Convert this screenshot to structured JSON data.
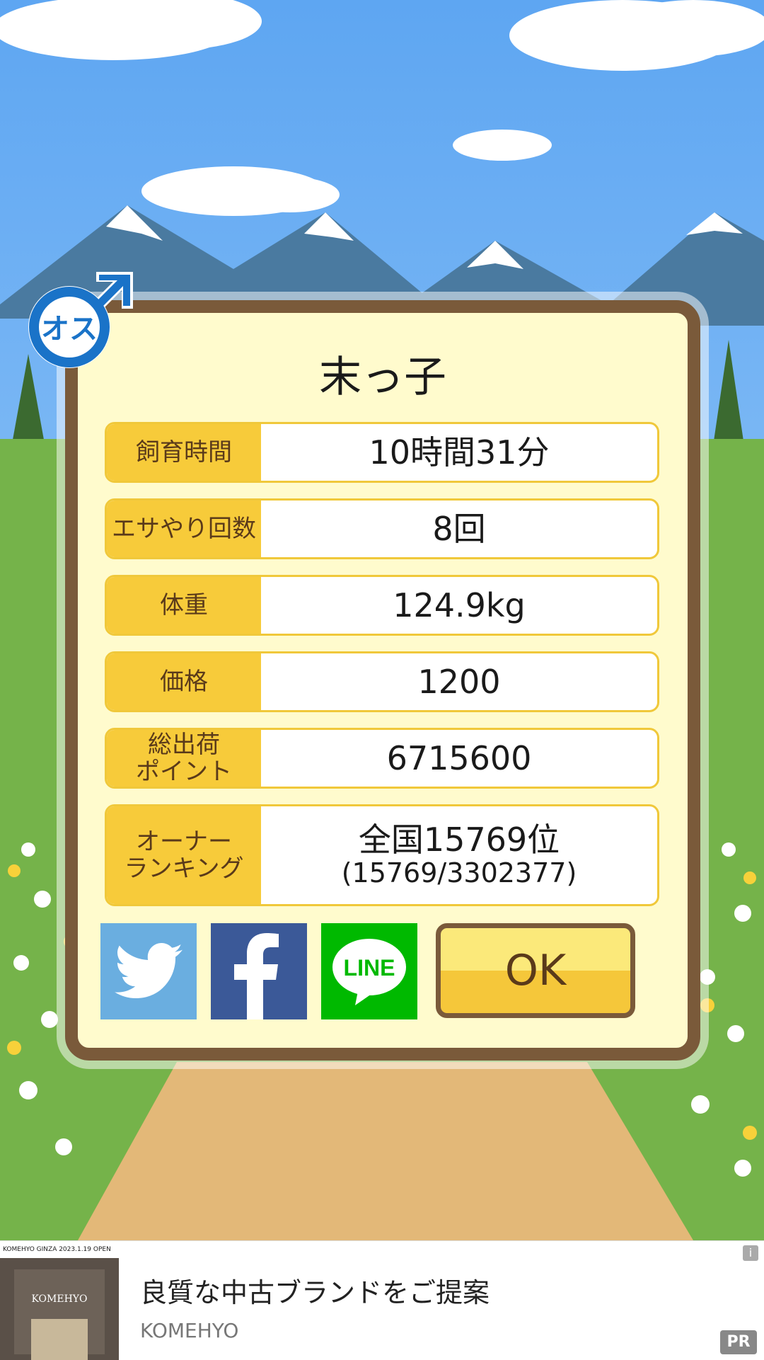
{
  "pig": {
    "name": "末っ子",
    "gender_label": "オス"
  },
  "stats": [
    {
      "label": "飼育時間",
      "value": "10時間31分"
    },
    {
      "label": "エサやり回数",
      "value": "8回"
    },
    {
      "label": "体重",
      "value": "124.9kg"
    },
    {
      "label": "価格",
      "value": "1200"
    },
    {
      "label_line1": "総出荷",
      "label_line2": "ポイント",
      "value": "6715600"
    },
    {
      "label_line1": "オーナー",
      "label_line2": "ランキング",
      "value": "全国15769位",
      "value_sub": "(15769/3302377)"
    }
  ],
  "share": {
    "twitter_icon": "twitter-icon",
    "facebook_icon": "facebook-icon",
    "line_label": "LINE"
  },
  "ok_label": "OK",
  "ad": {
    "title": "良質な中古ブランドをご提案",
    "brand": "KOMEHYO",
    "thumb_caption": "KOMEHYO GINZA 2023.1.19 OPEN",
    "thumb_logo": "KOMEHYO",
    "info_label": "i",
    "pr_label": "PR"
  },
  "colors": {
    "sky": "#6aaef5",
    "panel": "#fffbcd",
    "frame": "#7a5a3a",
    "label_bg": "#f7cb3a",
    "male_blue": "#1a73c8"
  }
}
